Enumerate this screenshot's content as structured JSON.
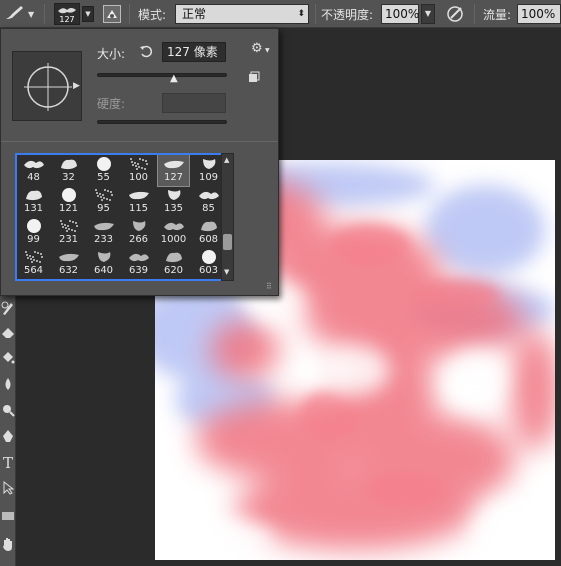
{
  "options_bar": {
    "brush_size_value": "127",
    "mode_label": "模式:",
    "mode_value": "正常",
    "opacity_label": "不透明度:",
    "opacity_value": "100%",
    "flow_label": "流量:",
    "flow_value": "100%"
  },
  "brush_panel": {
    "size_label": "大小:",
    "size_value": "127 像素",
    "hardness_label": "硬度:",
    "size_slider_level": 0.6,
    "presets": [
      {
        "size": "48"
      },
      {
        "size": "32"
      },
      {
        "size": "55"
      },
      {
        "size": "100"
      },
      {
        "size": "127",
        "selected": true
      },
      {
        "size": "109"
      },
      {
        "size": "131"
      },
      {
        "size": "121"
      },
      {
        "size": "95"
      },
      {
        "size": "115"
      },
      {
        "size": "135"
      },
      {
        "size": "85"
      },
      {
        "size": "99"
      },
      {
        "size": "231"
      },
      {
        "size": "233"
      },
      {
        "size": "266"
      },
      {
        "size": "1000"
      },
      {
        "size": "608"
      },
      {
        "size": "564"
      },
      {
        "size": "632"
      },
      {
        "size": "640"
      },
      {
        "size": "639"
      },
      {
        "size": "620"
      },
      {
        "size": "603"
      }
    ]
  },
  "colors": {
    "accent": "#3b7cf0",
    "canvas_background": "#ffffff",
    "paint_red": "#f06a78",
    "paint_blue": "#a9b6f2"
  },
  "icons": {
    "brush_tool": "brush-icon",
    "brush_panel_toggle": "brush-panel-icon",
    "airbrush": "airbrush-icon",
    "reset": "reset-size-icon",
    "settings": "gear-icon",
    "new_preset": "new-preset-icon"
  }
}
